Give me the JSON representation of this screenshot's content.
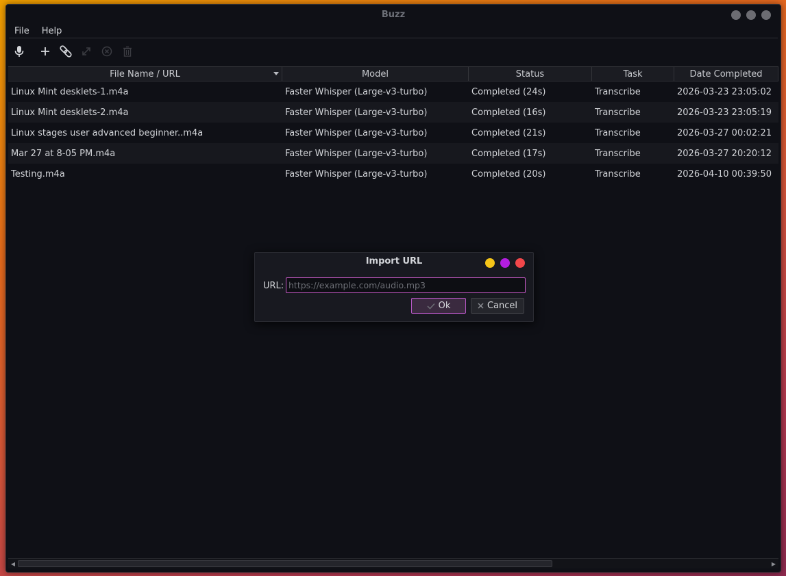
{
  "window": {
    "title": "Buzz",
    "control_color": "#6c6c72"
  },
  "menu": {
    "file": "File",
    "help": "Help"
  },
  "toolbar": {
    "icons": [
      "microphone-icon",
      "plus-icon",
      "link-icon",
      "expand-icon",
      "cancel-icon",
      "trash-icon"
    ],
    "disabled": [
      "expand-icon",
      "cancel-icon",
      "trash-icon"
    ]
  },
  "table": {
    "columns": [
      "File Name / URL",
      "Model",
      "Status",
      "Task",
      "Date Completed"
    ],
    "sort_column": "File Name / URL",
    "rows": [
      [
        "Linux Mint desklets-1.m4a",
        "Faster Whisper (Large-v3-turbo)",
        "Completed (24s)",
        "Transcribe",
        "2026-03-23 23:05:02"
      ],
      [
        "Linux Mint desklets-2.m4a",
        "Faster Whisper (Large-v3-turbo)",
        "Completed (16s)",
        "Transcribe",
        "2026-03-23 23:05:19"
      ],
      [
        "Linux stages user advanced beginner..m4a",
        "Faster Whisper (Large-v3-turbo)",
        "Completed (21s)",
        "Transcribe",
        "2026-03-27 00:02:21"
      ],
      [
        "Mar 27 at 8-05 PM.m4a",
        "Faster Whisper (Large-v3-turbo)",
        "Completed (17s)",
        "Transcribe",
        "2026-03-27 20:20:12"
      ],
      [
        "Testing.m4a",
        "Faster Whisper (Large-v3-turbo)",
        "Completed (20s)",
        "Transcribe",
        "2026-04-10 00:39:50"
      ]
    ]
  },
  "dialog": {
    "title": "Import URL",
    "url_label": "URL:",
    "url_value": "",
    "url_placeholder": "https://example.com/audio.mp3",
    "ok_label": "Ok",
    "cancel_label": "Cancel",
    "dot_colors": [
      "#f5c518",
      "#b41ee0",
      "#f2474a"
    ]
  },
  "colors": {
    "accent": "#c85ac8"
  }
}
